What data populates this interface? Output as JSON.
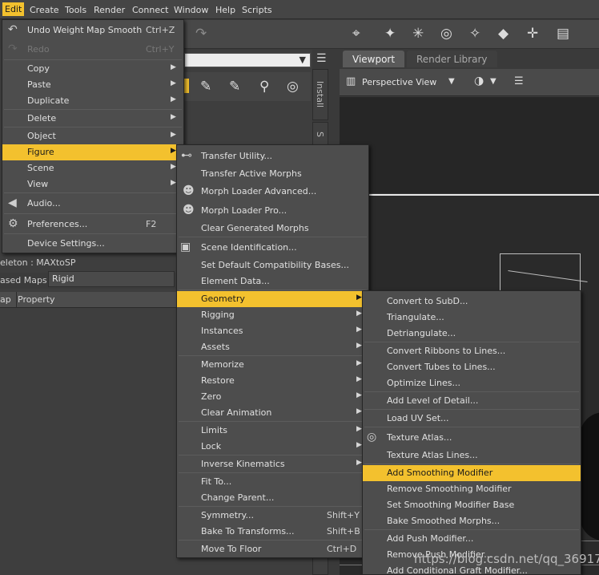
{
  "menubar": {
    "items": [
      "Edit",
      "Create",
      "Tools",
      "Render",
      "Connect",
      "Window",
      "Help",
      "Scripts"
    ]
  },
  "left_panel": {
    "skeleton_text": "eleton : MAXtoSP",
    "maps_label": "ased Maps :",
    "maps_value": "Rigid",
    "col_map": "ap",
    "col_property": "Property"
  },
  "side_tabs": {
    "install": "Install",
    "s": "S"
  },
  "viewport": {
    "tabs": [
      "Viewport",
      "Render Library"
    ],
    "camera_label": "Perspective View"
  },
  "edit_menu": {
    "items": [
      {
        "label": "Undo Weight Map Smooth",
        "shortcut": "Ctrl+Z",
        "icon": "undo-icon"
      },
      {
        "label": "Redo",
        "shortcut": "Ctrl+Y",
        "icon": "redo-icon",
        "disabled": true
      },
      {
        "label": "Copy"
      },
      {
        "label": "Paste"
      },
      {
        "label": "Duplicate"
      },
      {
        "label": "Delete"
      },
      {
        "label": "Object"
      },
      {
        "label": "Figure",
        "highlight": true
      },
      {
        "label": "Scene"
      },
      {
        "label": "View"
      },
      {
        "label": "Audio...",
        "icon": "audio-icon"
      },
      {
        "label": "Preferences...",
        "shortcut": "F2",
        "icon": "preferences-icon"
      },
      {
        "label": "Device Settings..."
      }
    ]
  },
  "figure_menu": {
    "items": [
      {
        "label": "Transfer Utility...",
        "icon": "transfer-utility-icon"
      },
      {
        "label": "Transfer Active Morphs"
      },
      {
        "label": "Morph Loader Advanced...",
        "icon": "morph-loader-advanced-icon"
      },
      {
        "label": "Morph Loader Pro...",
        "icon": "morph-loader-pro-icon"
      },
      {
        "label": "Clear Generated Morphs"
      },
      {
        "label": "Scene Identification...",
        "icon": "scene-identification-icon"
      },
      {
        "label": "Set Default Compatibility Bases..."
      },
      {
        "label": "Element Data..."
      },
      {
        "label": "Geometry",
        "highlight": true
      },
      {
        "label": "Rigging"
      },
      {
        "label": "Instances"
      },
      {
        "label": "Assets"
      },
      {
        "label": "Memorize"
      },
      {
        "label": "Restore"
      },
      {
        "label": "Zero"
      },
      {
        "label": "Clear Animation"
      },
      {
        "label": "Limits"
      },
      {
        "label": "Lock"
      },
      {
        "label": "Inverse Kinematics"
      },
      {
        "label": "Fit To..."
      },
      {
        "label": "Change Parent..."
      },
      {
        "label": "Symmetry...",
        "shortcut": "Shift+Y"
      },
      {
        "label": "Bake To Transforms...",
        "shortcut": "Shift+B"
      },
      {
        "label": "Move To Floor",
        "shortcut": "Ctrl+D"
      }
    ]
  },
  "geometry_menu": {
    "items": [
      {
        "label": "Convert to SubD..."
      },
      {
        "label": "Triangulate..."
      },
      {
        "label": "Detriangulate..."
      },
      {
        "label": "Convert Ribbons to Lines..."
      },
      {
        "label": "Convert Tubes to Lines..."
      },
      {
        "label": "Optimize Lines..."
      },
      {
        "label": "Add Level of Detail..."
      },
      {
        "label": "Load UV Set..."
      },
      {
        "label": "Texture Atlas...",
        "icon": "texture-atlas-icon"
      },
      {
        "label": "Texture Atlas Lines..."
      },
      {
        "label": "Add Smoothing Modifier",
        "highlight": true
      },
      {
        "label": "Remove Smoothing Modifier"
      },
      {
        "label": "Set Smoothing Modifier Base"
      },
      {
        "label": "Bake Smoothed Morphs..."
      },
      {
        "label": "Add Push Modifier..."
      },
      {
        "label": "Remove Push Modifier..."
      },
      {
        "label": "Add Conditional Graft Modifier..."
      }
    ]
  },
  "watermark": "https://blog.csdn.net/qq_36917144",
  "colors": {
    "highlight": "#f3c12e",
    "menu_bg": "#4d4d4d",
    "app_bg": "#3a3a3a"
  }
}
